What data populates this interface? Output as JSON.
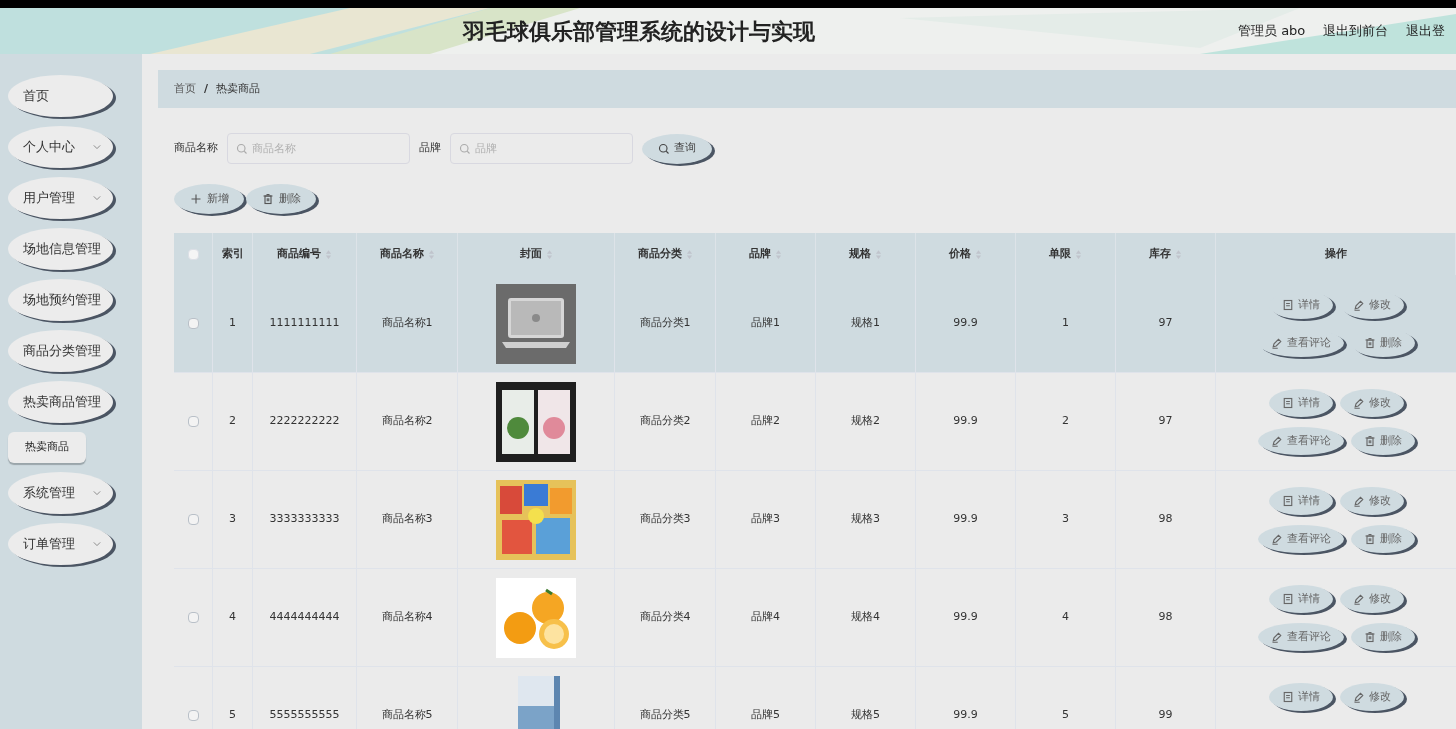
{
  "header": {
    "title": "羽毛球俱乐部管理系统的设计与实现",
    "user": "管理员 abo",
    "links": [
      "退出到前台",
      "退出登"
    ]
  },
  "sidebar": {
    "items": [
      {
        "label": "首页",
        "caret": false
      },
      {
        "label": "个人中心",
        "caret": true
      },
      {
        "label": "用户管理",
        "caret": true
      },
      {
        "label": "场地信息管理",
        "caret": false
      },
      {
        "label": "场地预约管理",
        "caret": false
      },
      {
        "label": "商品分类管理",
        "caret": false
      },
      {
        "label": "热卖商品管理",
        "caret": false,
        "expanded": true,
        "children": [
          {
            "label": "热卖商品",
            "selected": true
          }
        ]
      },
      {
        "label": "系统管理",
        "caret": true
      },
      {
        "label": "订单管理",
        "caret": true
      }
    ]
  },
  "breadcrumb": {
    "items": [
      "首页",
      "热卖商品"
    ],
    "separator": "/"
  },
  "search": {
    "fields": [
      {
        "label": "商品名称",
        "placeholder": "商品名称"
      },
      {
        "label": "品牌",
        "placeholder": "品牌"
      }
    ],
    "button": "查询"
  },
  "toolbar": [
    "新增",
    "删除"
  ],
  "table": {
    "select_all_checked": false,
    "columns": [
      {
        "label": "索引",
        "sortable": false
      },
      {
        "label": "商品编号",
        "sortable": true
      },
      {
        "label": "商品名称",
        "sortable": true
      },
      {
        "label": "封面",
        "sortable": true
      },
      {
        "label": "商品分类",
        "sortable": true
      },
      {
        "label": "品牌",
        "sortable": true
      },
      {
        "label": "规格",
        "sortable": true
      },
      {
        "label": "价格",
        "sortable": true
      },
      {
        "label": "单限",
        "sortable": true
      },
      {
        "label": "库存",
        "sortable": true
      },
      {
        "label": "操作",
        "sortable": false
      }
    ],
    "rows": [
      {
        "checked": false,
        "highlighted": true,
        "cells": [
          "1",
          "1111111111",
          "商品名称1",
          {
            "kind": "picture"
          },
          "商品分类1",
          "品牌1",
          "规格1",
          "99.9",
          "1",
          "97"
        ],
        "actions": [
          "详情",
          "修改",
          "查看评论",
          "删除"
        ]
      },
      {
        "checked": false,
        "highlighted": false,
        "cells": [
          "2",
          "2222222222",
          "商品名称2",
          {
            "kind": "picture"
          },
          "商品分类2",
          "品牌2",
          "规格2",
          "99.9",
          "2",
          "97"
        ],
        "actions": [
          "详情",
          "修改",
          "查看评论",
          "删除"
        ]
      },
      {
        "checked": false,
        "highlighted": false,
        "cells": [
          "3",
          "3333333333",
          "商品名称3",
          {
            "kind": "picture"
          },
          "商品分类3",
          "品牌3",
          "规格3",
          "99.9",
          "3",
          "98"
        ],
        "actions": [
          "详情",
          "修改",
          "查看评论",
          "删除"
        ]
      },
      {
        "checked": false,
        "highlighted": false,
        "cells": [
          "4",
          "4444444444",
          "商品名称4",
          {
            "kind": "picture"
          },
          "商品分类4",
          "品牌4",
          "规格4",
          "99.9",
          "4",
          "98"
        ],
        "actions": [
          "详情",
          "修改",
          "查看评论",
          "删除"
        ]
      },
      {
        "checked": false,
        "highlighted": false,
        "cells": [
          "5",
          "5555555555",
          "商品名称5",
          {
            "kind": "picture"
          },
          "商品分类5",
          "品牌5",
          "规格5",
          "99.9",
          "5",
          "99"
        ],
        "actions": [
          "详情",
          "修改"
        ]
      }
    ]
  }
}
